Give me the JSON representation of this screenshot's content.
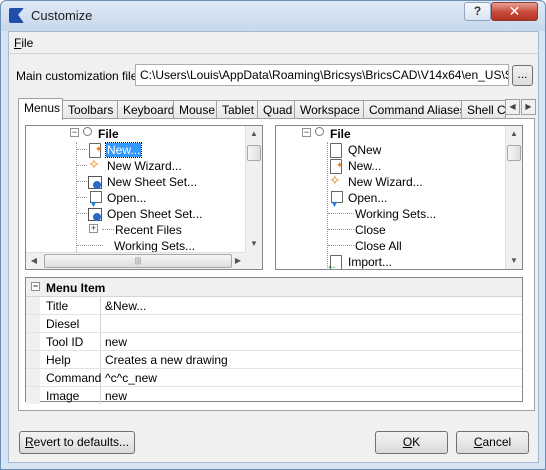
{
  "window": {
    "title": "Customize",
    "help": "?",
    "close": "✕"
  },
  "menubar": {
    "file_underlined": "F",
    "file_rest": "ile"
  },
  "main_customization": {
    "label": "Main customization file:",
    "value": "C:\\Users\\Louis\\AppData\\Roaming\\Bricsys\\BricsCAD\\V14x64\\en_US\\Support\\",
    "browse_label": "..."
  },
  "tabs": [
    {
      "label": "Menus",
      "active": true
    },
    {
      "label": "Toolbars"
    },
    {
      "label": "Keyboard"
    },
    {
      "label": "Mouse"
    },
    {
      "label": "Tablet"
    },
    {
      "label": "Quad"
    },
    {
      "label": "Workspace"
    },
    {
      "label": "Command Aliases"
    },
    {
      "label": "Shell C"
    }
  ],
  "left_tree": {
    "root": "File",
    "items": [
      {
        "label": "New...",
        "icon": "new-document-icon",
        "selected": true
      },
      {
        "label": "New Wizard...",
        "icon": "wizard-icon"
      },
      {
        "label": "New Sheet Set...",
        "icon": "sheet-set-icon"
      },
      {
        "label": "Open...",
        "icon": "open-icon"
      },
      {
        "label": "Open Sheet Set...",
        "icon": "open-sheet-set-icon"
      },
      {
        "label": "Recent Files",
        "icon": "expand-icon"
      },
      {
        "label": "Working Sets...",
        "icon": ""
      }
    ]
  },
  "right_tree": {
    "root": "File",
    "items": [
      {
        "label": "QNew",
        "icon": "qnew-icon"
      },
      {
        "label": "New...",
        "icon": "new-document-icon"
      },
      {
        "label": "New Wizard...",
        "icon": "wizard-icon"
      },
      {
        "label": "Open...",
        "icon": "open-icon"
      },
      {
        "label": "Working Sets...",
        "icon": ""
      },
      {
        "label": "Close",
        "icon": ""
      },
      {
        "label": "Close All",
        "icon": ""
      },
      {
        "label": "Import...",
        "icon": "import-icon"
      }
    ]
  },
  "properties": {
    "header": "Menu Item",
    "rows": [
      {
        "name": "Title",
        "value": "&New..."
      },
      {
        "name": "Diesel",
        "value": ""
      },
      {
        "name": "Tool ID",
        "value": "new"
      },
      {
        "name": "Help",
        "value": "Creates a new drawing"
      },
      {
        "name": "Command",
        "value": "^c^c_new"
      },
      {
        "name": "Image",
        "value": "new"
      }
    ]
  },
  "buttons": {
    "revert_u": "R",
    "revert_rest": "evert to defaults...",
    "ok_u": "O",
    "ok_rest": "K",
    "cancel_u": "C",
    "cancel_rest": "ancel"
  }
}
